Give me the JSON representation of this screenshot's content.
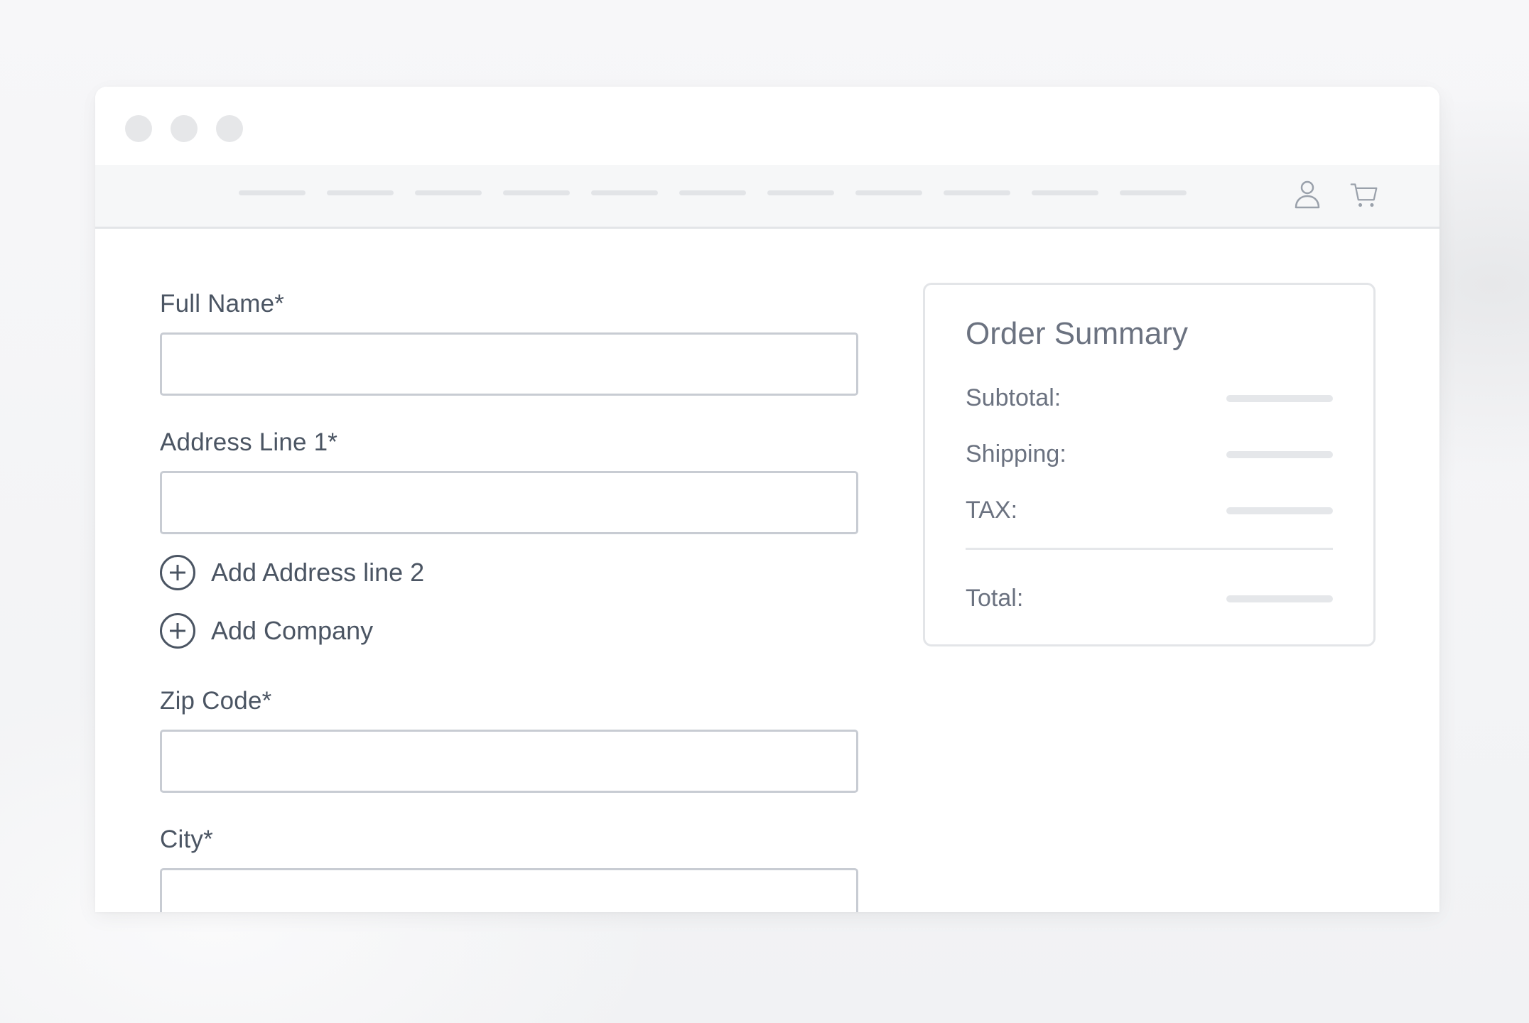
{
  "window": {
    "controls": [
      "close",
      "minimize",
      "maximize"
    ]
  },
  "navbar": {
    "links_count_label": "",
    "icons": [
      "user-icon",
      "cart-icon"
    ]
  },
  "form": {
    "full_name": {
      "label": "Full Name*",
      "value": "",
      "placeholder": ""
    },
    "address_line_1": {
      "label": "Address Line 1*",
      "value": "",
      "placeholder": ""
    },
    "add_address_line_2": {
      "label": "Add Address line 2"
    },
    "add_company": {
      "label": "Add Company"
    },
    "zip_code": {
      "label": "Zip Code*",
      "value": "",
      "placeholder": ""
    },
    "city": {
      "label": "City*",
      "value": "",
      "placeholder": ""
    }
  },
  "summary": {
    "title": "Order Summary",
    "rows": [
      {
        "label": "Subtotal:"
      },
      {
        "label": "Shipping:"
      },
      {
        "label": "TAX:"
      }
    ],
    "total": {
      "label": "Total:"
    }
  },
  "colors": {
    "text": "#4b5563",
    "muted_text": "#6b7280",
    "border": "#c8ccd3",
    "placeholder_bar": "#e5e7ea"
  }
}
